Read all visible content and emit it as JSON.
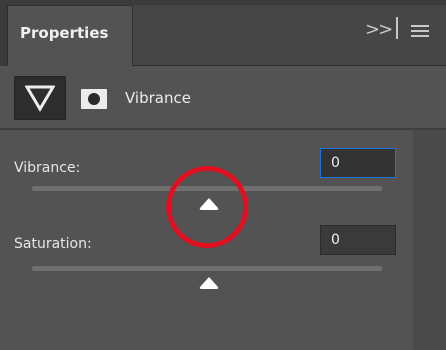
{
  "panel": {
    "tab_label": "Properties",
    "expand_glyph": ">>"
  },
  "adjustment": {
    "title": "Vibrance",
    "icon": "vibrance-triangle-icon",
    "mask_icon": "layer-mask-icon"
  },
  "controls": [
    {
      "label": "Vibrance:",
      "value": "0",
      "slider_fraction": 0.5,
      "focused": true
    },
    {
      "label": "Saturation:",
      "value": "0",
      "slider_fraction": 0.5,
      "focused": false
    }
  ],
  "colors": {
    "panel_bg": "#535353",
    "focus_border": "#1e73d6",
    "annotation_circle": "#e01020"
  }
}
